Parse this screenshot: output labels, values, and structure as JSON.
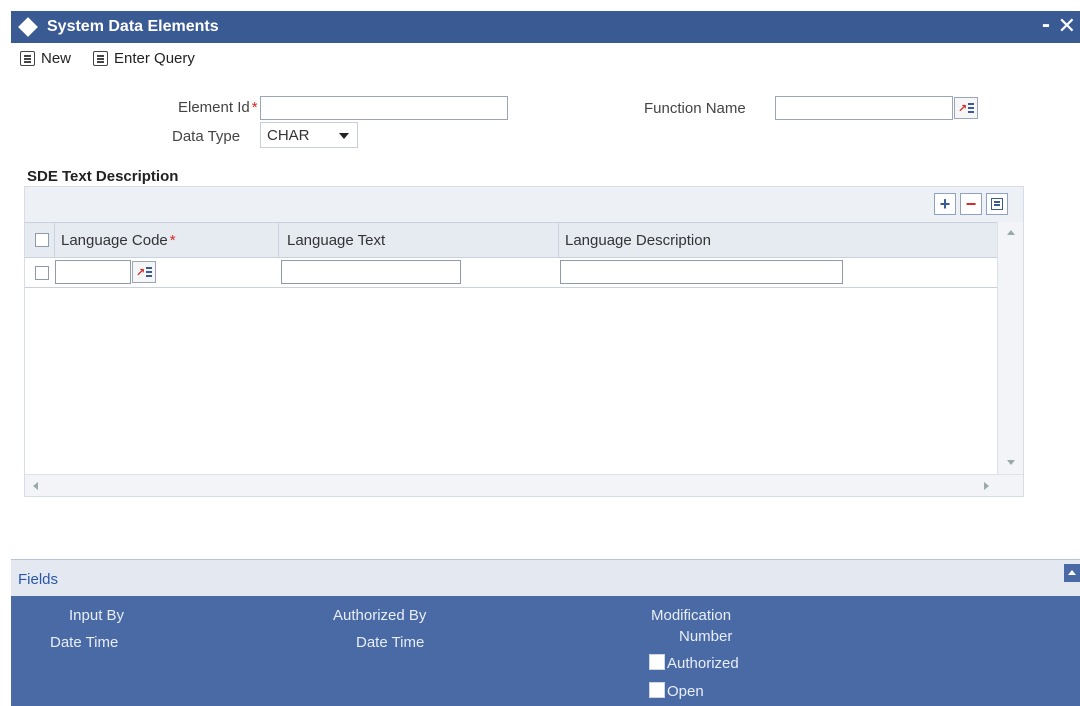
{
  "window": {
    "title": "System Data Elements",
    "minimize": "-",
    "close": "✕"
  },
  "toolbar": {
    "new_label": "New",
    "enter_query_label": "Enter Query"
  },
  "form": {
    "element_id_label": "Element Id",
    "required_mark": "*",
    "element_id_value": "",
    "data_type_label": "Data Type",
    "data_type_value": "CHAR",
    "function_name_label": "Function Name",
    "function_name_value": ""
  },
  "sde_section": {
    "title": "SDE Text Description",
    "columns": [
      "Language Code",
      "Language Text",
      "Language Description"
    ],
    "rows": [
      {
        "language_code": "",
        "language_text": "",
        "language_description": ""
      }
    ]
  },
  "footer": {
    "fields_link": "Fields",
    "input_by": "Input By",
    "date_time_1": "Date Time",
    "authorized_by": "Authorized By",
    "date_time_2": "Date Time",
    "modification": "Modification",
    "number": "Number",
    "authorized": "Authorized",
    "open": "Open"
  },
  "colors": {
    "accent": "#3a5a94",
    "audit_bg": "#4a6aa6",
    "required": "#d22222"
  }
}
